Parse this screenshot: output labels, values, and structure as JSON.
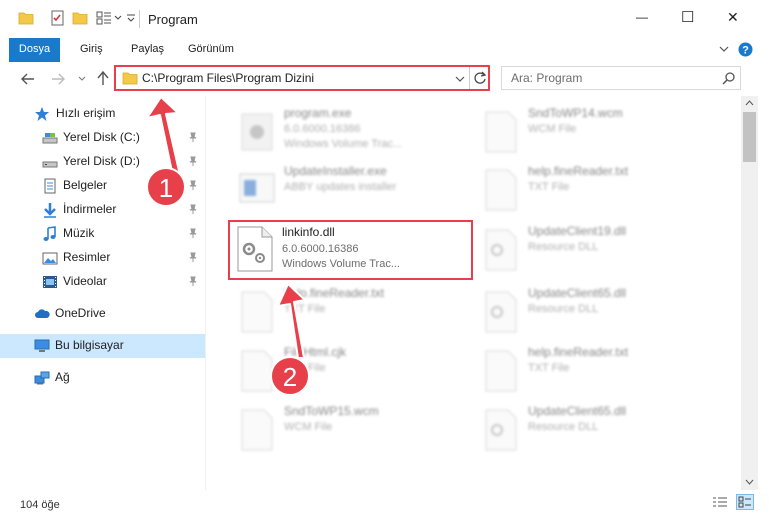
{
  "window": {
    "title": "Program",
    "minimize": "—",
    "maximize": "☐",
    "close": "✕"
  },
  "ribbon": {
    "tabs": [
      "Dosya",
      "Giriş",
      "Paylaş",
      "Görünüm"
    ]
  },
  "address": {
    "path": "C:\\Program Files\\Program Dizini",
    "search_placeholder": "Ara: Program"
  },
  "nav": {
    "quick_access": "Hızlı erişim",
    "items": [
      {
        "label": "Yerel Disk (C:)"
      },
      {
        "label": "Yerel Disk (D:)"
      },
      {
        "label": "Belgeler"
      },
      {
        "label": "İndirmeler"
      },
      {
        "label": "Müzik"
      },
      {
        "label": "Resimler"
      },
      {
        "label": "Videolar"
      }
    ],
    "onedrive": "OneDrive",
    "this_pc": "Bu bilgisayar",
    "network": "Ağ"
  },
  "files": {
    "left": [
      {
        "name": "program.exe",
        "line1": "6.0.6000.16386",
        "line2": "Windows Volume Trac..."
      },
      {
        "name": "UpdateInstaller.exe",
        "line1": "ABBY updates installer",
        "line2": ""
      },
      {
        "name": "linkinfo.dll",
        "line1": "6.0.6000.16386",
        "line2": "Windows Volume Trac..."
      },
      {
        "name": "help.fineReader.txt",
        "line1": "TXT File",
        "line2": ""
      },
      {
        "name": "FileHtml.cjk",
        "line1": "CJK File",
        "line2": ""
      },
      {
        "name": "SndToWP15.wcm",
        "line1": "WCM File",
        "line2": ""
      }
    ],
    "right": [
      {
        "name": "SndToWP14.wcm",
        "line1": "WCM File"
      },
      {
        "name": "help.fineReader.txt",
        "line1": "TXT File"
      },
      {
        "name": "UpdateClient19.dll",
        "line1": "Resource DLL"
      },
      {
        "name": "UpdateClient65.dll",
        "line1": "Resource DLL"
      },
      {
        "name": "help.fineReader.txt",
        "line1": "TXT File"
      },
      {
        "name": "UpdateClient65.dll",
        "line1": "Resource DLL"
      }
    ]
  },
  "annotations": {
    "step1": "1",
    "step2": "2",
    "color": "#e8404a"
  },
  "status": {
    "count": "104 öğe"
  }
}
